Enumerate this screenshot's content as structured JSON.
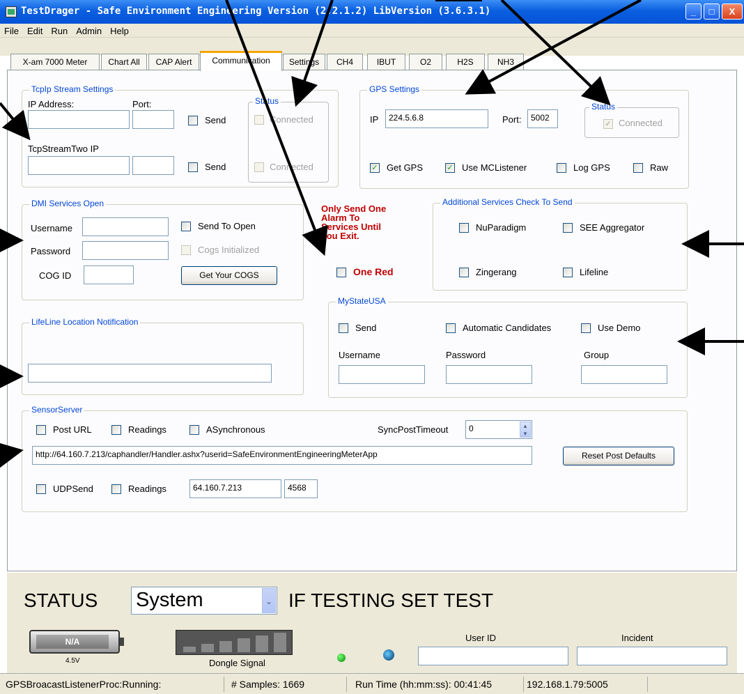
{
  "window": {
    "title": "TestDrager - Safe Environment Engineering Version (2.2.1.2) LibVersion (3.6.3.1)",
    "controls": {
      "minimize": "_",
      "maximize": "□",
      "close": "X"
    }
  },
  "menu": [
    "File",
    "Edit",
    "Run",
    "Admin",
    "Help"
  ],
  "tabs": [
    "X-am 7000 Meter",
    "Chart All",
    "CAP Alert",
    "Communication",
    "Settings",
    "CH4",
    "IBUT",
    "O2",
    "H2S",
    "NH3"
  ],
  "active_tab": "Communication",
  "tcpip": {
    "legend": "TcpIp Stream Settings",
    "ip_label": "IP Address:",
    "port_label": "Port:",
    "send_label": "Send",
    "two_label": "TcpStreamTwo IP",
    "send2_label": "Send",
    "ip_value": "",
    "port_value": "",
    "ip2_value": "",
    "port2_value": "",
    "status_legend": "Status",
    "connected_label": "Connected",
    "connected2_label": "Connected"
  },
  "gps": {
    "legend": "GPS Settings",
    "ip_label": "IP",
    "ip_value": "224.5.6.8",
    "port_label": "Port:",
    "port_value": "5002",
    "status_legend": "Status",
    "connected_label": "Connected",
    "get_gps": "Get GPS",
    "use_mclistener": "Use MCListener",
    "log_gps": "Log GPS",
    "raw": "Raw"
  },
  "dmi": {
    "legend": "DMI Services Open",
    "username_label": "Username",
    "password_label": "Password",
    "cog_label": "COG ID",
    "send_open": "Send To Open",
    "cogs_init": "Cogs Initialized",
    "get_cogs": "Get Your COGS"
  },
  "alarm": {
    "warning": "Only Send One Alarm To Services Until You Exit.",
    "warning_lines": [
      "Only Send One",
      "Alarm To",
      "Services Until",
      "You Exit."
    ],
    "one_red": "One Red"
  },
  "additional": {
    "legend": "Additional Services Check To Send",
    "nuparadigm": "NuParadigm",
    "see_aggregator": "SEE Aggregator",
    "zingerang": "Zingerang",
    "lifeline": "Lifeline"
  },
  "lifeline": {
    "legend": "LifeLine Location Notification",
    "value": ""
  },
  "mystate": {
    "legend": "MyStateUSA",
    "send": "Send",
    "automatic": "Automatic Candidates",
    "use_demo": "Use Demo",
    "username_label": "Username",
    "password_label": "Password",
    "group_label": "Group"
  },
  "sensor": {
    "legend": "SensorServer",
    "post_url": "Post URL",
    "readings": "Readings",
    "async": "ASynchronous",
    "sync_timeout_label": "SyncPostTimeout",
    "sync_timeout_value": "0",
    "url": "http://64.160.7.213/caphandler/Handler.ashx?userid=SafeEnvironmentEngineeringMeterApp",
    "reset_button": "Reset Post Defaults",
    "udp_send": "UDPSend",
    "readings2": "Readings",
    "udp_ip": "64.160.7.213",
    "udp_port": "4568"
  },
  "status_panel": {
    "status_label": "STATUS",
    "system_value": "System",
    "message": "IF TESTING SET TEST",
    "battery_text": "N/A",
    "battery_voltage": "4.5V",
    "dongle_label": "Dongle Signal",
    "user_id_label": "User ID",
    "incident_label": "Incident"
  },
  "statusbar": {
    "proc": "GPSBroacastListenerProc:Running:",
    "samples": "# Samples: 1669",
    "runtime": "Run Time (hh:mm:ss): 00:41:45",
    "address": "192.168.1.79:5005"
  },
  "colors": {
    "titlebar": "#0a5fe0",
    "legend": "#0046d5",
    "warning": "#c00000",
    "tab_active_accent": "#f6a500"
  }
}
